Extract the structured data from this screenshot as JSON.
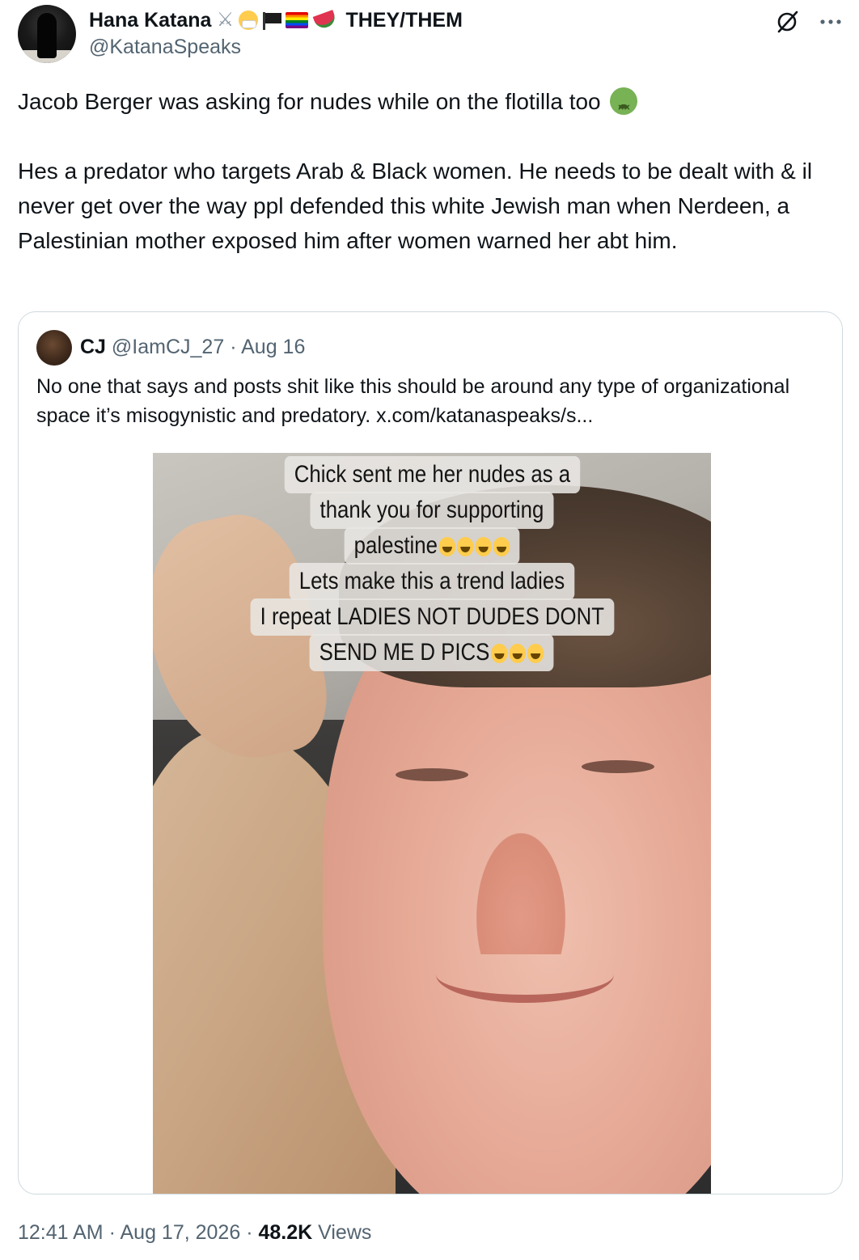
{
  "author": {
    "display_name": "Hana Katana",
    "pronouns": "THEY/THEM",
    "handle": "@KatanaSpeaks",
    "name_emojis": [
      "crossed-swords-icon",
      "mask-face-icon",
      "black-flag-icon",
      "rainbow-flag-icon",
      "watermelon-icon"
    ]
  },
  "tweet": {
    "paragraph_1": "Jacob Berger was asking for nudes while on the flotilla too",
    "paragraph_1_emoji": "nauseated-face-icon",
    "paragraph_2": "Hes a predator who targets Arab & Black women. He needs to be dealt with & il never get over the way ppl defended this white Jewish man when Nerdeen, a Palestinian mother exposed him after women warned her abt him."
  },
  "quote": {
    "name": "CJ",
    "handle": "@IamCJ_27",
    "separator": "·",
    "date": "Aug 16",
    "text": "No one that says and posts shit like this should be around any type of organizational space it’s misogynistic and predatory.  x.com/katanaspeaks/s...",
    "media": {
      "overlay_lines": [
        "Chick sent me her nudes as a",
        "thank you for supporting",
        "palestine",
        "Lets make this a trend ladies",
        "I repeat LADIES NOT DUDES DONT",
        "SEND ME D PICS"
      ],
      "laugh_emoji_counts": [
        0,
        0,
        4,
        0,
        0,
        3
      ]
    }
  },
  "footer": {
    "time": "12:41 AM",
    "sep1": "·",
    "date": "Aug 17, 2026",
    "sep2": "·",
    "views_count": "48.2K",
    "views_label": "Views"
  },
  "colors": {
    "text_primary": "#0f1419",
    "text_secondary": "#536471",
    "border": "#cfd9de"
  }
}
